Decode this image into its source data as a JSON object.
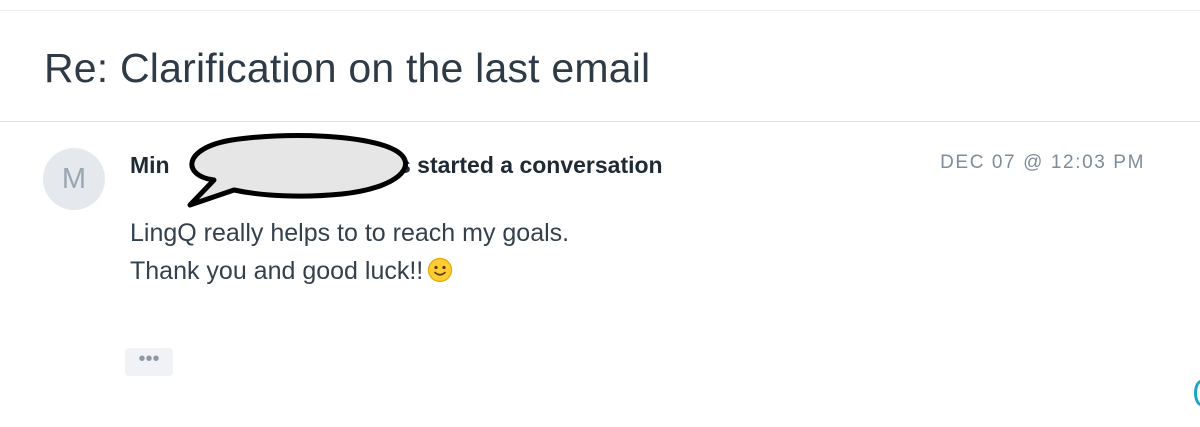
{
  "conversation": {
    "subject": "Re: Clarification on the last email",
    "message": {
      "avatar_initial": "M",
      "sender_visible_prefix": "Min",
      "action_text": "s started a conversation",
      "timestamp": "DEC 07 @ 12:03 PM",
      "body_lines": [
        "LingQ really helps to to reach my goals.",
        "Thank you and good luck!!"
      ],
      "emoji": "slightly-smiling-face-icon",
      "more_label": "•••"
    }
  },
  "colors": {
    "subject_text": "#2e3a46",
    "timestamp_text": "#7f8c99",
    "avatar_bg": "#e5e9ee",
    "accent": "#1aa3c8"
  }
}
